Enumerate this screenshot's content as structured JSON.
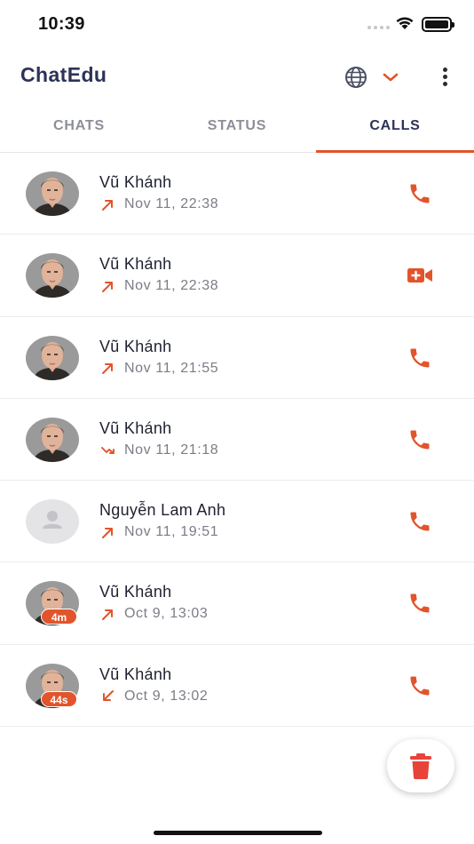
{
  "status_bar": {
    "time": "10:39"
  },
  "app_bar": {
    "title": "ChatEdu"
  },
  "tabs": [
    {
      "label": "CHATS",
      "active": false
    },
    {
      "label": "STATUS",
      "active": false
    },
    {
      "label": "CALLS",
      "active": true
    }
  ],
  "calls": [
    {
      "name": "Vũ Khánh",
      "time": "Nov 11, 22:38",
      "direction": "outgoing",
      "type": "voice",
      "avatar": "photo",
      "duration": ""
    },
    {
      "name": "Vũ Khánh",
      "time": "Nov 11, 22:38",
      "direction": "outgoing",
      "type": "video",
      "avatar": "photo",
      "duration": ""
    },
    {
      "name": "Vũ Khánh",
      "time": "Nov 11, 21:55",
      "direction": "outgoing",
      "type": "voice",
      "avatar": "photo",
      "duration": ""
    },
    {
      "name": "Vũ Khánh",
      "time": "Nov 11, 21:18",
      "direction": "missed",
      "type": "voice",
      "avatar": "photo",
      "duration": ""
    },
    {
      "name": "Nguyễn Lam Anh",
      "time": "Nov 11, 19:51",
      "direction": "outgoing",
      "type": "voice",
      "avatar": "placeholder",
      "duration": ""
    },
    {
      "name": "Vũ Khánh",
      "time": "Oct 9, 13:03",
      "direction": "outgoing",
      "type": "voice",
      "avatar": "photo",
      "duration": "4m"
    },
    {
      "name": "Vũ Khánh",
      "time": "Oct 9, 13:02",
      "direction": "incoming",
      "type": "voice",
      "avatar": "photo",
      "duration": "44s"
    }
  ],
  "colors": {
    "accent": "#e2542b",
    "title": "#2c3356",
    "muted": "#7b7d87",
    "divider": "#ececf0",
    "delete": "#e8433b"
  },
  "icons": {
    "globe": "globe-icon",
    "chevron": "chevron-down-icon",
    "menu": "more-vertical-icon",
    "voice": "phone-icon",
    "video": "video-call-icon",
    "delete": "trash-icon"
  }
}
